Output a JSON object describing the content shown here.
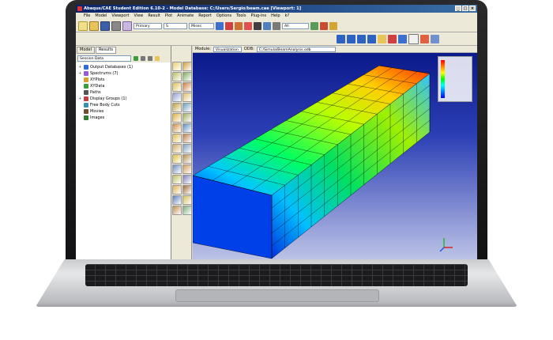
{
  "app": {
    "title": "Abaqus/CAE Student Edition 6.10-2 - Model Database: C:/Users/Sergio/beam.cae [Viewport: 1]",
    "window_buttons": [
      "_",
      "□",
      "×"
    ]
  },
  "menu": [
    "File",
    "Model",
    "Viewport",
    "View",
    "Result",
    "Plot",
    "Animate",
    "Report",
    "Options",
    "Tools",
    "Plug-ins",
    "Help",
    "k?"
  ],
  "toolbar": {
    "step_combo": "Primary",
    "field_combo": "S",
    "invariant_combo": "Mises",
    "render_combo": "All"
  },
  "left_panel": {
    "tabs": [
      "Model",
      "Results"
    ],
    "active_tab": "Results",
    "session_combo": "Session Data",
    "tree": [
      {
        "label": "Output Databases (1)",
        "expand": "+",
        "icon_color": "#2e6bd8"
      },
      {
        "label": "Spectrums (7)",
        "expand": "+",
        "icon_color": "#9a5bd6"
      },
      {
        "label": "XYPlots",
        "expand": "",
        "icon_color": "#d6a02b"
      },
      {
        "label": "XYData",
        "expand": "",
        "icon_color": "#3a9e3a"
      },
      {
        "label": "Paths",
        "expand": "",
        "icon_color": "#555555"
      },
      {
        "label": "Display Groups (1)",
        "expand": "+",
        "icon_color": "#c44040"
      },
      {
        "label": "Free Body Cuts",
        "expand": "",
        "icon_color": "#3a8fb0"
      },
      {
        "label": "Movies",
        "expand": "",
        "icon_color": "#705030"
      },
      {
        "label": "Images",
        "expand": "",
        "icon_color": "#2f7d2f"
      }
    ]
  },
  "context_bar": {
    "module_label": "Module:",
    "module_value": "Visualization",
    "odb_label": "ODB:",
    "odb_value": "C:/Simula/BeamAnalysis.odb"
  },
  "colors": {
    "title_bar": "#0a246a",
    "viewport_top": "#0b1a8a",
    "viewport_bottom": "#bcc3e6"
  }
}
